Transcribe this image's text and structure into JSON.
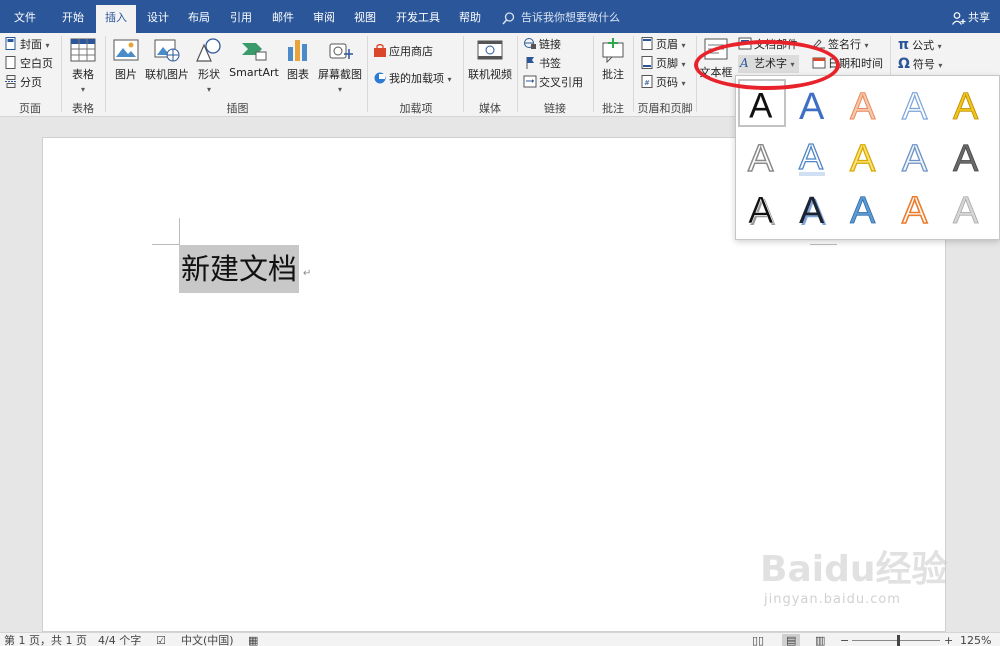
{
  "tabs": [
    {
      "label": "文件",
      "active": false
    },
    {
      "label": "开始",
      "active": false
    },
    {
      "label": "插入",
      "active": true
    },
    {
      "label": "设计",
      "active": false
    },
    {
      "label": "布局",
      "active": false
    },
    {
      "label": "引用",
      "active": false
    },
    {
      "label": "邮件",
      "active": false
    },
    {
      "label": "审阅",
      "active": false
    },
    {
      "label": "视图",
      "active": false
    },
    {
      "label": "开发工具",
      "active": false
    },
    {
      "label": "帮助",
      "active": false
    }
  ],
  "tell_me": {
    "placeholder": "告诉我你想要做什么",
    "icon": "lightbulb-search-icon"
  },
  "share": {
    "label": "共享",
    "icon": "person-add-icon"
  },
  "ribbon": {
    "pages": {
      "cover": "封面",
      "blank_page": "空白页",
      "page_break": "分页",
      "label": "页面"
    },
    "tables": {
      "table": "表格",
      "label": "表格"
    },
    "illustrations": {
      "picture": "图片",
      "online_picture": "联机图片",
      "shapes": "形状",
      "smartart": "SmartArt",
      "chart": "图表",
      "screenshot": "屏幕截图",
      "label": "插图"
    },
    "addins": {
      "store": "应用商店",
      "my_addins": "我的加载项",
      "label": "加载项"
    },
    "media": {
      "online_video": "联机视频",
      "label": "媒体"
    },
    "links": {
      "link": "链接",
      "bookmark": "书签",
      "cross_reference": "交叉引用",
      "label": "链接"
    },
    "comments": {
      "comment": "批注",
      "label": "批注"
    },
    "header_footer": {
      "header": "页眉",
      "footer": "页脚",
      "page_number": "页码",
      "label": "页眉和页脚"
    },
    "text": {
      "text_box": "文本框",
      "quick_parts": "文档部件",
      "wordart": "艺术字",
      "signature_line": "签名行",
      "date_time": "日期和时间"
    },
    "symbols": {
      "equation": "公式",
      "symbol": "符号"
    }
  },
  "document": {
    "text": "新建文档"
  },
  "wordart_gallery": {
    "styles": [
      {
        "glyph": "A",
        "style": "plain-black",
        "selected": true
      },
      {
        "glyph": "A",
        "style": "blue-fill"
      },
      {
        "glyph": "A",
        "style": "orange-gradient"
      },
      {
        "glyph": "A",
        "style": "blue-outline"
      },
      {
        "glyph": "A",
        "style": "gold-fill"
      },
      {
        "glyph": "A",
        "style": "gray-outline"
      },
      {
        "glyph": "A",
        "style": "blue-reflection"
      },
      {
        "glyph": "A",
        "style": "gold-outline"
      },
      {
        "glyph": "A",
        "style": "blue-outline-2"
      },
      {
        "glyph": "A",
        "style": "gray-fill"
      },
      {
        "glyph": "A",
        "style": "black-shadow"
      },
      {
        "glyph": "A",
        "style": "black-blue-shadow"
      },
      {
        "glyph": "A",
        "style": "blue-bevel"
      },
      {
        "glyph": "A",
        "style": "orange-outline"
      },
      {
        "glyph": "A",
        "style": "silver-gradient"
      }
    ]
  },
  "status": {
    "page": "第 1 页，共 1 页",
    "words": "4/4 个字",
    "language": "中文(中国)",
    "zoom": "125%"
  },
  "watermark": {
    "brand": "Baidu经验",
    "url": "jingyan.baidu.com"
  },
  "colors": {
    "accent": "#2b579a",
    "highlight_circle": "#e8222a"
  }
}
